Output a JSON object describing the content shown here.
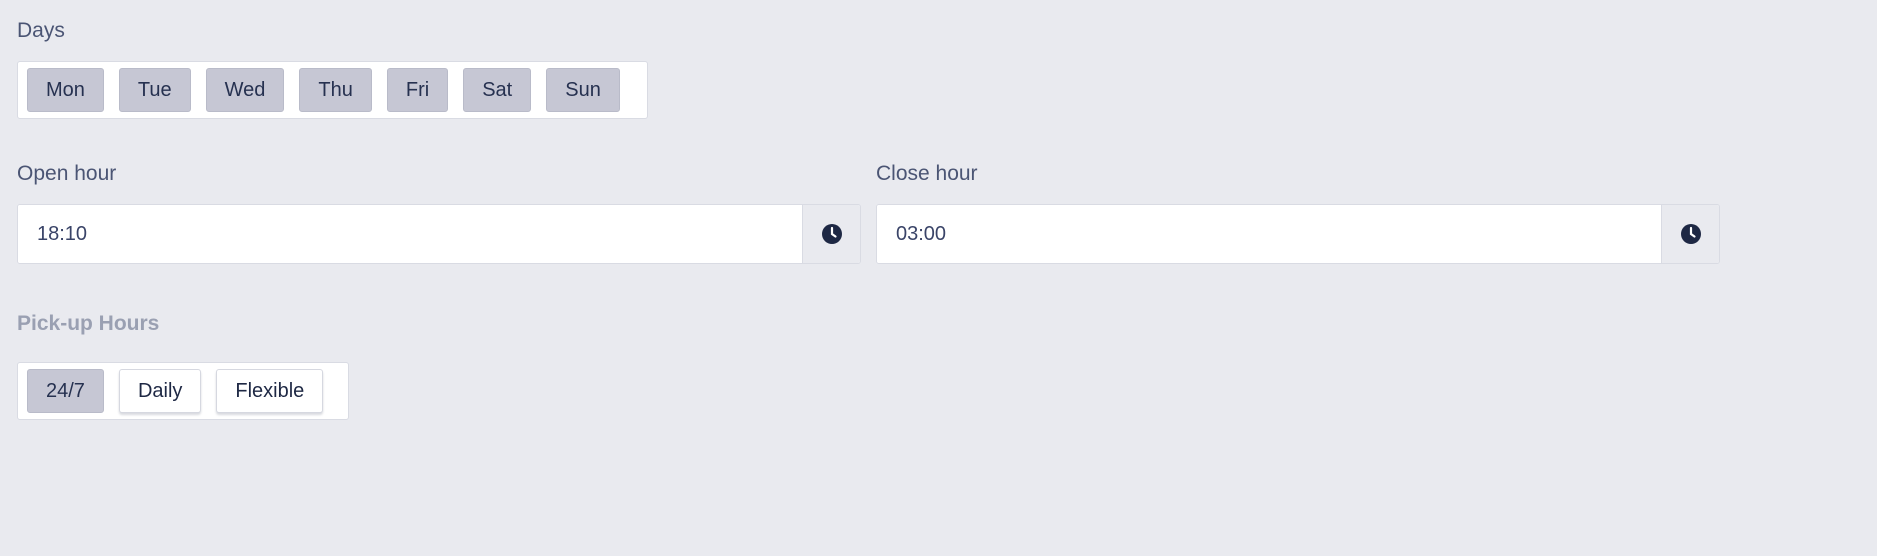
{
  "days": {
    "label": "Days",
    "options": [
      {
        "label": "Mon",
        "selected": true
      },
      {
        "label": "Tue",
        "selected": true
      },
      {
        "label": "Wed",
        "selected": true
      },
      {
        "label": "Thu",
        "selected": true
      },
      {
        "label": "Fri",
        "selected": true
      },
      {
        "label": "Sat",
        "selected": true
      },
      {
        "label": "Sun",
        "selected": true
      }
    ]
  },
  "open_hour": {
    "label": "Open hour",
    "value": "18:10",
    "icon": "clock-icon"
  },
  "close_hour": {
    "label": "Close hour",
    "value": "03:00",
    "icon": "clock-icon"
  },
  "pickup_hours": {
    "label": "Pick-up Hours",
    "options": [
      {
        "label": "24/7",
        "selected": true
      },
      {
        "label": "Daily",
        "selected": false
      },
      {
        "label": "Flexible",
        "selected": false
      }
    ]
  },
  "colors": {
    "background": "#e9eaef",
    "chip_selected": "#c6c7d4",
    "icon": "#1e2844"
  }
}
